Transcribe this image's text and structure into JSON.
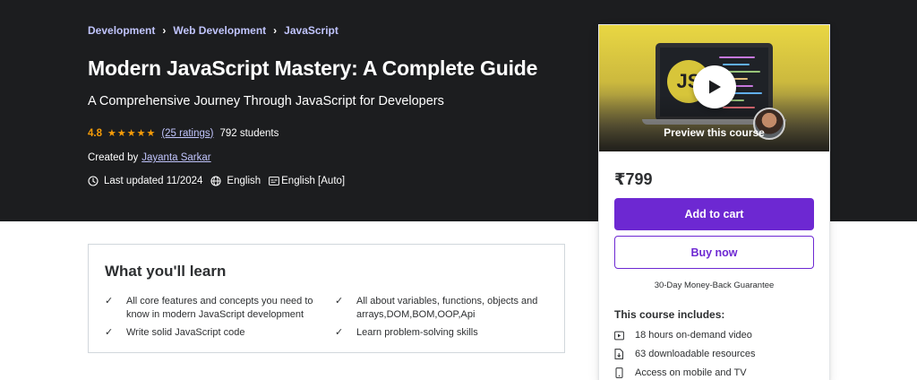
{
  "breadcrumb": {
    "items": [
      "Development",
      "Web Development",
      "JavaScript"
    ],
    "separator": "›"
  },
  "course": {
    "title": "Modern JavaScript Mastery: A Complete Guide",
    "subtitle": "A Comprehensive Journey Through JavaScript for Developers",
    "rating": "4.8",
    "stars": "★★★★★",
    "ratings_count": "(25 ratings)",
    "students": "792 students",
    "created_by_label": "Created by",
    "author": "Jayanta Sarkar",
    "last_updated": "Last updated 11/2024",
    "language": "English",
    "captions": "English [Auto]"
  },
  "learn": {
    "title": "What you'll learn",
    "check_glyph": "✓",
    "items": [
      "All core features and concepts you need to know in modern JavaScript development",
      "All about variables, functions, objects and arrays,DOM,BOM,OOP,Api",
      "Write solid JavaScript code",
      "Learn problem-solving skills"
    ]
  },
  "sidebar": {
    "preview_label": "Preview this course",
    "thumbnail_text": "JS",
    "price": "₹799",
    "add_to_cart": "Add to cart",
    "buy_now": "Buy now",
    "guarantee": "30-Day Money-Back Guarantee",
    "includes_title": "This course includes:",
    "includes": [
      {
        "icon": "video-icon",
        "label": "18 hours on-demand video"
      },
      {
        "icon": "file-download-icon",
        "label": "63 downloadable resources"
      },
      {
        "icon": "mobile-icon",
        "label": "Access on mobile and TV"
      }
    ]
  },
  "colors": {
    "hero_bg": "#1c1d1f",
    "accent_purple": "#6d28d2",
    "link_lavender": "#c0c4fc",
    "star_orange": "#f69c08"
  }
}
